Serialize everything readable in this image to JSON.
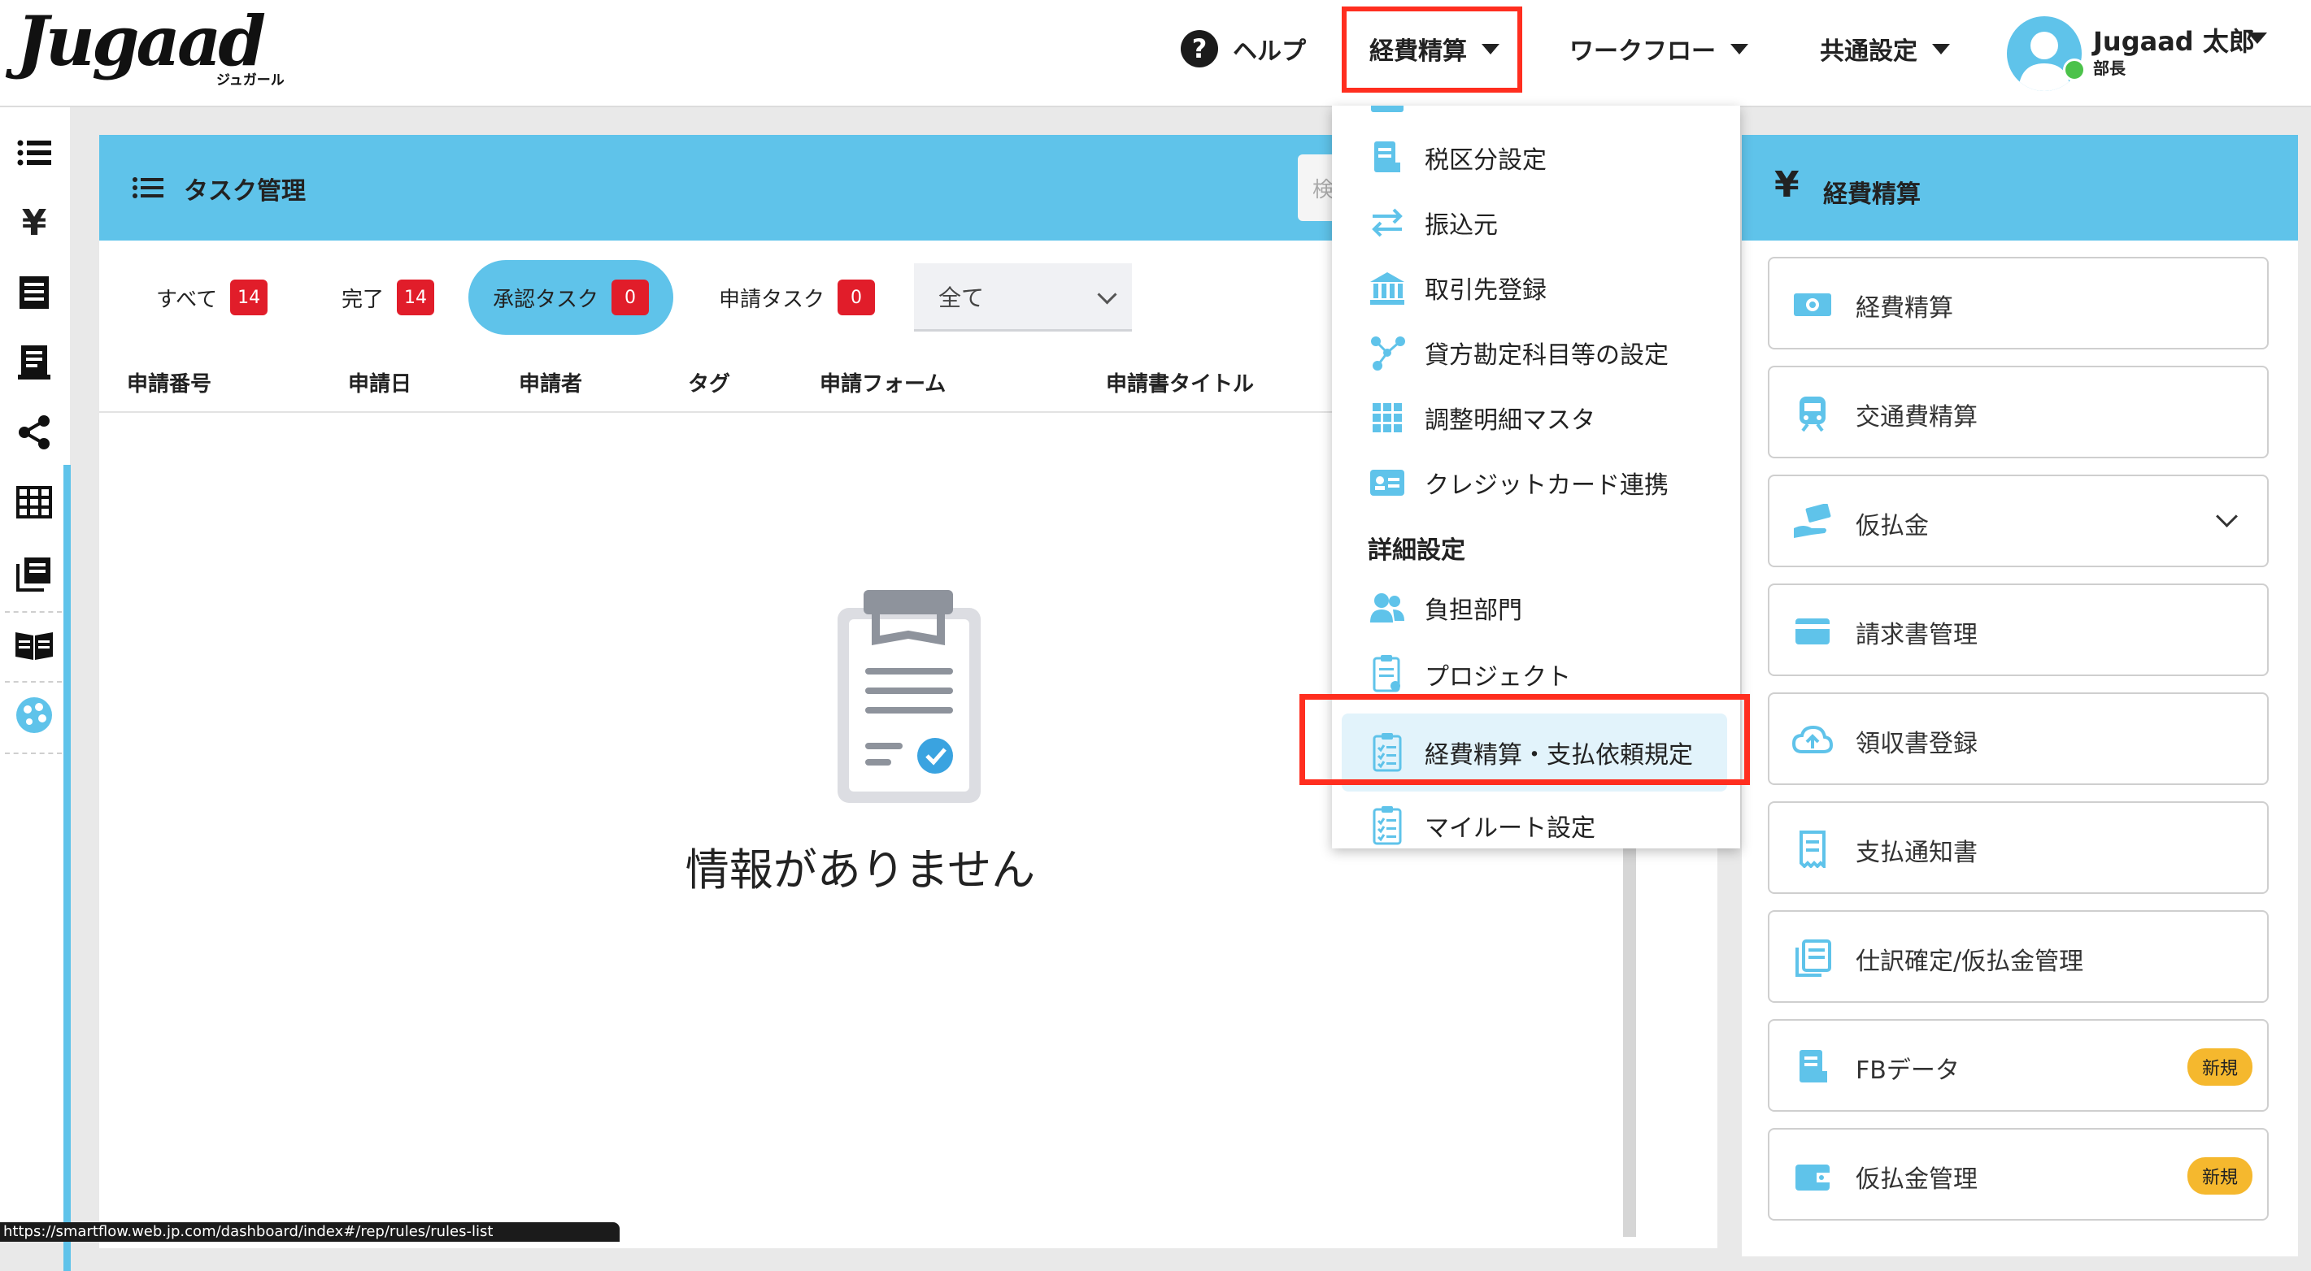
{
  "header": {
    "logo_text": "Jugaad",
    "logo_subtext": "ジュガール",
    "nav": {
      "help": "ヘルプ",
      "expense": "経費精算",
      "workflow": "ワークフロー",
      "common": "共通設定"
    },
    "user": {
      "name": "Jugaad 太郎",
      "role": "部長"
    }
  },
  "sidebar": {
    "icons": [
      "list-icon",
      "yen-icon",
      "receipt-icon",
      "document-icon",
      "share-icon",
      "grid-icon",
      "stack-icon",
      "book-icon",
      "palette-icon"
    ]
  },
  "task_panel": {
    "title": "タスク管理",
    "search_placeholder": "検",
    "filters": [
      {
        "label": "すべて",
        "count": "14"
      },
      {
        "label": "完了",
        "count": "14"
      },
      {
        "label": "承認タスク",
        "count": "0"
      },
      {
        "label": "申請タスク",
        "count": "0"
      }
    ],
    "select_value": "全て",
    "columns": [
      "申請番号",
      "申請日",
      "申請者",
      "タグ",
      "申請フォーム",
      "申請書タイトル"
    ],
    "empty_message": "情報がありません"
  },
  "dropdown": {
    "items": [
      {
        "label": "税区分設定",
        "icon": "document-icon"
      },
      {
        "label": "振込元",
        "icon": "transfer-icon"
      },
      {
        "label": "取引先登録",
        "icon": "bank-icon"
      },
      {
        "label": "貸方勘定科目等の設定",
        "icon": "nodes-icon"
      },
      {
        "label": "調整明細マスタ",
        "icon": "grid-icon"
      },
      {
        "label": "クレジットカード連携",
        "icon": "card-icon"
      }
    ],
    "section_title": "詳細設定",
    "detail_items": [
      {
        "label": "負担部門",
        "icon": "users-icon"
      },
      {
        "label": "プロジェクト",
        "icon": "clipboard-icon"
      },
      {
        "label": "経費精算・支払依頼規定",
        "icon": "checklist-icon"
      },
      {
        "label": "マイルート設定",
        "icon": "checklist-icon"
      }
    ]
  },
  "right_panel": {
    "title": "経費精算",
    "cards": [
      {
        "label": "経費精算",
        "icon": "money-icon"
      },
      {
        "label": "交通費精算",
        "icon": "train-icon"
      },
      {
        "label": "仮払金",
        "icon": "hand-money-icon",
        "expandable": true
      },
      {
        "label": "請求書管理",
        "icon": "card-icon"
      },
      {
        "label": "領収書登録",
        "icon": "cloud-upload-icon"
      },
      {
        "label": "支払通知書",
        "icon": "receipt-icon"
      },
      {
        "label": "仕訳確定/仮払金管理",
        "icon": "copy-doc-icon"
      },
      {
        "label": "FBデータ",
        "icon": "document-icon",
        "badge": "新規"
      },
      {
        "label": "仮払金管理",
        "icon": "wallet-icon",
        "badge": "新規"
      }
    ]
  },
  "statusbar": {
    "url": "https://smartflow.web.jp.com/dashboard/index#/rep/rules/rules-list"
  },
  "colors": {
    "accent": "#5fc3ea",
    "badge_red": "#e11d2a",
    "highlight_red": "#ff2e1f",
    "new_badge": "#f5b82e"
  }
}
